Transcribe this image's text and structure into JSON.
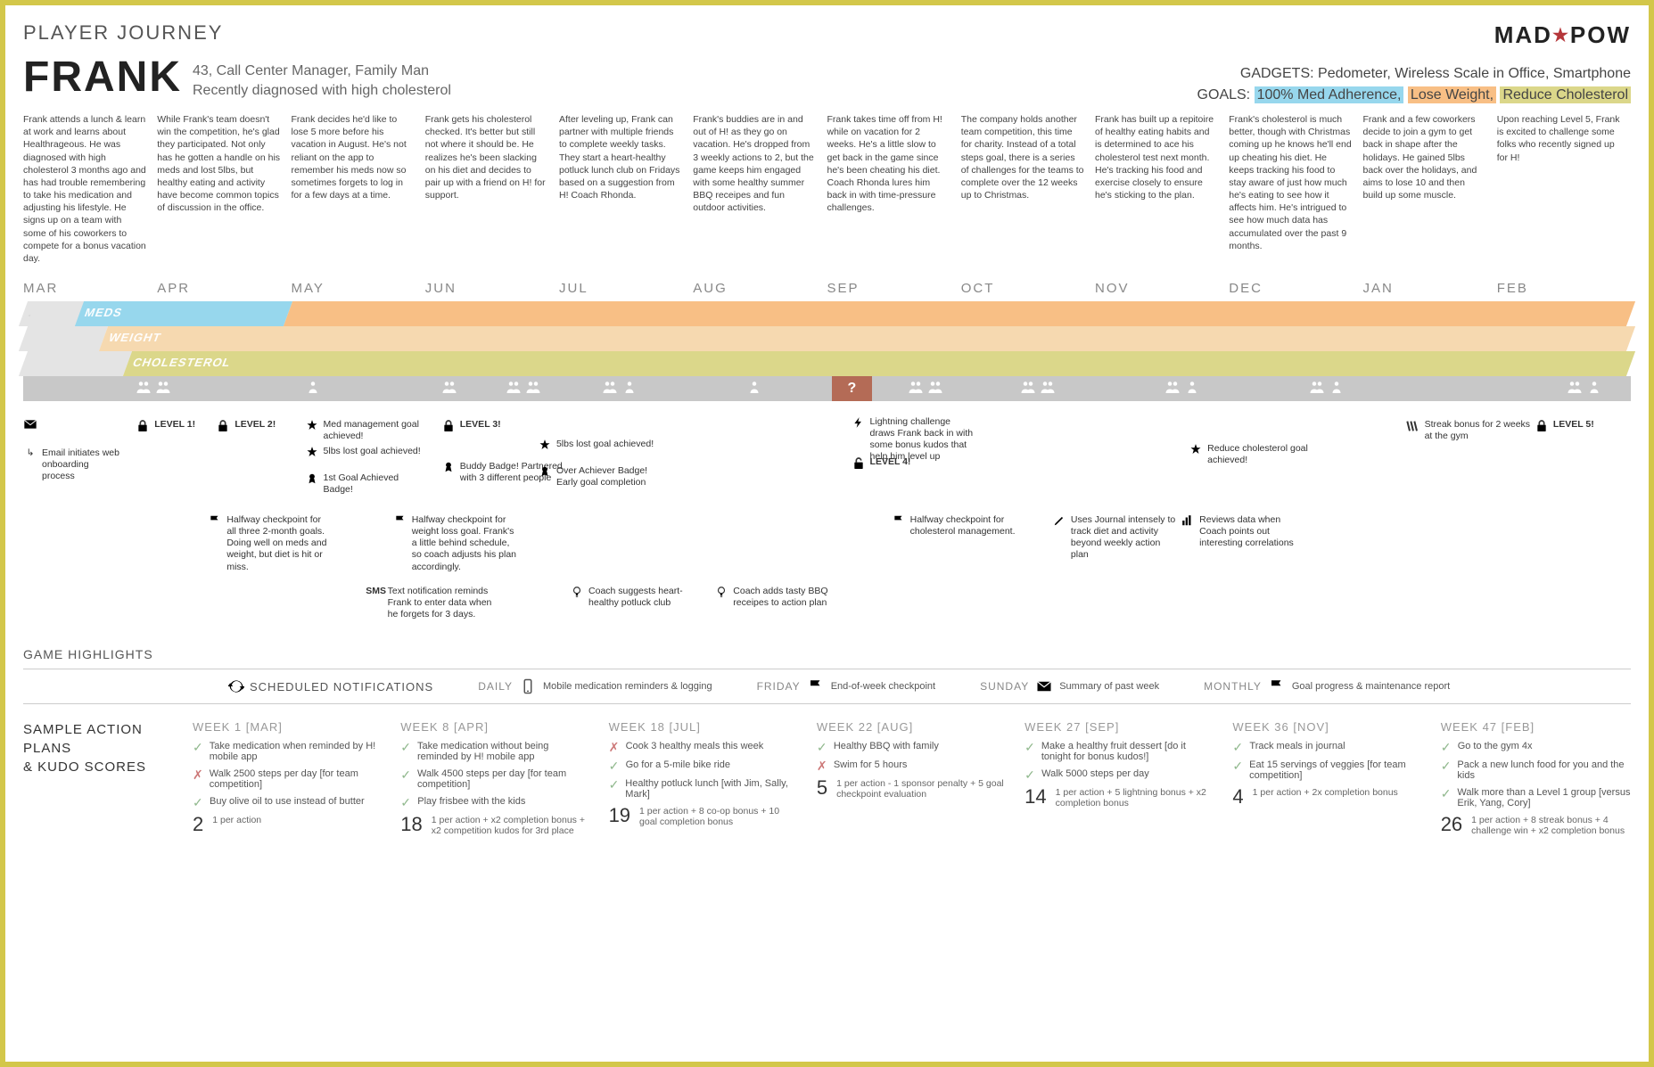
{
  "title": "PLAYER JOURNEY",
  "logo": {
    "left": "MAD",
    "star": "★",
    "right": "POW"
  },
  "persona": {
    "name": "FRANK",
    "line1": "43, Call Center Manager, Family Man",
    "line2": "Recently diagnosed with high cholesterol",
    "gadgets_label": "GADGETS:",
    "gadgets": "Pedometer, Wireless Scale in Office, Smartphone",
    "goals_label": "GOALS:",
    "goal1": "100% Med Adherence,",
    "goal2": "Lose Weight,",
    "goal3": "Reduce Cholesterol"
  },
  "months": [
    {
      "abbr": "MAR",
      "text": "Frank attends a lunch & learn at work and learns about Healthrageous. He was diagnosed with high cholesterol 3 months ago and has had trouble remembering to take his medication and adjusting his lifestyle. He signs up on a team with some of his coworkers to compete for a bonus vacation day."
    },
    {
      "abbr": "APR",
      "text": "While Frank's team doesn't win the competition, he's glad they participated. Not only has he gotten a handle on his meds and lost 5lbs, but healthy eating and activity have become common topics of discussion in the office."
    },
    {
      "abbr": "MAY",
      "text": "Frank decides he'd like to lose 5 more before his vacation in August. He's not reliant on the app to remember his meds now so sometimes forgets to log in for a few days at a time."
    },
    {
      "abbr": "JUN",
      "text": "Frank gets his cholesterol checked. It's better but still not where it should be. He realizes he's been slacking on his diet and decides to pair up with a friend on H! for support."
    },
    {
      "abbr": "JUL",
      "text": "After leveling up, Frank can partner with multiple friends to complete weekly tasks. They start a heart-healthy potluck lunch club on Fridays based on a suggestion from H! Coach Rhonda."
    },
    {
      "abbr": "AUG",
      "text": "Frank's buddies are in and out of H! as they go on vacation. He's dropped from 3 weekly actions to 2, but the game keeps him engaged with some healthy summer BBQ receipes and fun outdoor activities."
    },
    {
      "abbr": "SEP",
      "text": "Frank takes time off from H! while on vacation for 2 weeks. He's a little slow to get back in the game since he's been cheating his diet. Coach Rhonda lures him back in with time-pressure challenges."
    },
    {
      "abbr": "OCT",
      "text": "The company holds another team competition, this time for charity. Instead of a total steps goal, there is a series of challenges for the teams to complete over the 12 weeks up to Christmas."
    },
    {
      "abbr": "NOV",
      "text": "Frank has built up a repitoire of healthy eating habits and is determined to ace his cholesterol test next month. He's tracking his food and exercise closely to ensure he's sticking to the plan."
    },
    {
      "abbr": "DEC",
      "text": "Frank's cholesterol is much better, though with Christmas coming up he knows he'll end up cheating his diet. He keeps tracking his food to stay aware of just how much he's eating to see how it affects him. He's intrigued to see how much data has accumulated over the past 9 months."
    },
    {
      "abbr": "JAN",
      "text": "Frank and a few coworkers decide to join a gym to get back in shape after the holidays. He gained 5lbs back over the holidays, and aims to lose 10 and then build up some muscle."
    },
    {
      "abbr": "FEB",
      "text": "Upon reaching Level 5, Frank is excited to challenge some folks who recently signed up for H!"
    }
  ],
  "tracks": {
    "meds": "MEDS",
    "weight": "WEIGHT",
    "chol": "CHOLESTEROL"
  },
  "events": {
    "email": "Email initiates web onboarding process",
    "level1": "LEVEL 1!",
    "level2": "LEVEL 2!",
    "level3": "LEVEL 3!",
    "level4": "LEVEL 4!",
    "level5": "LEVEL 5!",
    "medgoal": "Med management goal achieved!",
    "fivelbs": "5lbs lost goal achieved!",
    "firstgoal": "1st Goal Achieved Badge!",
    "halfway1": "Halfway checkpoint for all three 2-month goals. Doing well on meds and weight, but diet is hit or miss.",
    "halfway2": "Halfway checkpoint for weight loss goal. Frank's a little behind schedule, so coach adjusts his plan accordingly.",
    "halfway3": "Halfway checkpoint for cholesterol management.",
    "buddy": "Buddy Badge! Partnered with 3 different people",
    "fivelbs2": "5lbs lost goal achieved!",
    "overachiever": "Over Achiever Badge! Early goal completion",
    "lightning": "Lightning challenge draws Frank back in with some bonus kudos that help him level up",
    "journal": "Uses Journal intensely to track diet and activity beyond weekly action plan",
    "reviewdata": "Reviews data when Coach points out interesting correlations",
    "reducechol": "Reduce cholesterol goal achieved!",
    "streak": "Streak bonus for 2 weeks at the gym",
    "sms_label": "SMS",
    "sms": "Text notification reminds Frank to enter data when he forgets for 3 days.",
    "coach1": "Coach suggests heart-healthy potluck club",
    "coach2": "Coach adds tasty BBQ receipes to action plan"
  },
  "highlights": "GAME HIGHLIGHTS",
  "notifications": {
    "title": "SCHEDULED NOTIFICATIONS",
    "daily": {
      "label": "DAILY",
      "text": "Mobile medication reminders & logging"
    },
    "friday": {
      "label": "FRIDAY",
      "text": "End-of-week checkpoint"
    },
    "sunday": {
      "label": "SUNDAY",
      "text": "Summary of past week"
    },
    "monthly": {
      "label": "MONTHLY",
      "text": "Goal progress & maintenance report"
    }
  },
  "plans": {
    "header1": "SAMPLE ACTION PLANS",
    "header2": "& KUDO SCORES",
    "weeks": [
      {
        "label": "WEEK 1 [MAR]",
        "items": [
          {
            "done": true,
            "text": "Take medication when reminded by H! mobile app"
          },
          {
            "done": false,
            "text": "Walk 2500 steps per day [for team competition]"
          },
          {
            "done": true,
            "text": "Buy olive oil to use instead of butter"
          }
        ],
        "score": "2",
        "score_text": "1 per action"
      },
      {
        "label": "WEEK 8 [APR]",
        "items": [
          {
            "done": true,
            "text": "Take medication without being reminded by H! mobile app"
          },
          {
            "done": true,
            "text": "Walk 4500 steps per day [for team competition]"
          },
          {
            "done": true,
            "text": "Play frisbee with the kids"
          }
        ],
        "score": "18",
        "score_text": "1 per action + x2 completion bonus + x2 competition kudos for 3rd place"
      },
      {
        "label": "WEEK 18 [JUL]",
        "items": [
          {
            "done": false,
            "text": "Cook 3 healthy meals this week"
          },
          {
            "done": true,
            "text": "Go for a 5-mile bike ride"
          },
          {
            "done": true,
            "text": "Healthy potluck lunch [with Jim, Sally, Mark]"
          }
        ],
        "score": "19",
        "score_text": "1 per action + 8 co-op bonus + 10 goal completion bonus"
      },
      {
        "label": "WEEK 22 [AUG]",
        "items": [
          {
            "done": true,
            "text": "Healthy BBQ with family"
          },
          {
            "done": false,
            "text": "Swim for 5 hours"
          }
        ],
        "score": "5",
        "score_text": "1 per action - 1 sponsor penalty + 5 goal checkpoint evaluation"
      },
      {
        "label": "WEEK 27 [SEP]",
        "items": [
          {
            "done": true,
            "text": "Make a healthy fruit dessert [do it tonight for bonus kudos!]"
          },
          {
            "done": true,
            "text": "Walk 5000 steps per day"
          }
        ],
        "score": "14",
        "score_text": "1 per action + 5 lightning bonus + x2 completion bonus"
      },
      {
        "label": "WEEK 36 [NOV]",
        "items": [
          {
            "done": true,
            "text": "Track meals in journal"
          },
          {
            "done": true,
            "text": "Eat 15 servings of veggies [for team competition]"
          }
        ],
        "score": "4",
        "score_text": "1 per action + 2x completion bonus"
      },
      {
        "label": "WEEK 47 [FEB]",
        "items": [
          {
            "done": true,
            "text": "Go to the gym 4x"
          },
          {
            "done": true,
            "text": "Pack a new lunch food for you and the kids"
          },
          {
            "done": true,
            "text": "Walk more than a Level 1 group [versus Erik, Yang, Cory]"
          }
        ],
        "score": "26",
        "score_text": "1 per action + 8 streak bonus + 4 challenge win + x2 completion bonus"
      }
    ]
  }
}
